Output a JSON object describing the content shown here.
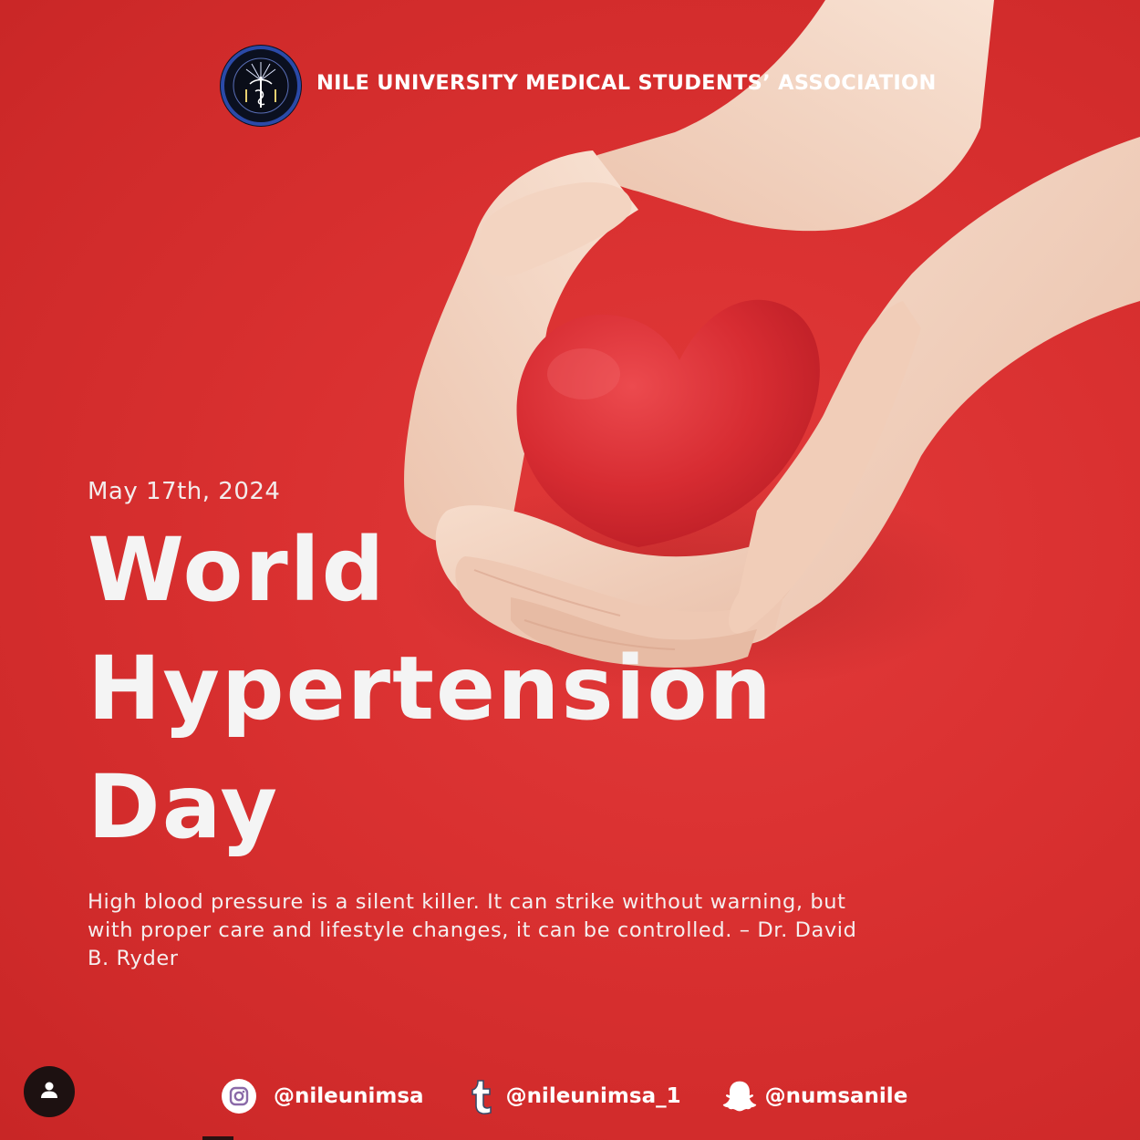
{
  "header": {
    "org_name": "NILE UNIVERSITY MEDICAL STUDENTS’ ASSOCIATION",
    "logo_icon": "numsa-caduceus-seal-icon"
  },
  "main": {
    "date": "May 17th, 2024",
    "title_lines": [
      "World",
      "Hypertension",
      "Day"
    ],
    "quote": "High blood pressure is a silent killer. It can strike without warning, but with proper care and lifestyle changes, it can be controlled. – Dr. David B. Ryder"
  },
  "footer": {
    "socials": [
      {
        "icon": "instagram-icon",
        "handle": "@nileunimsa"
      },
      {
        "icon": "tumblr-icon",
        "handle": "@nileunimsa_1"
      },
      {
        "icon": "snapchat-icon",
        "handle": "@numsanile"
      }
    ]
  },
  "avatar_icon": "user-icon",
  "colors": {
    "background": "#d93030",
    "heart": "#d42a2f",
    "text": "#ffffff",
    "logo_ring": "#2b4aa8"
  }
}
